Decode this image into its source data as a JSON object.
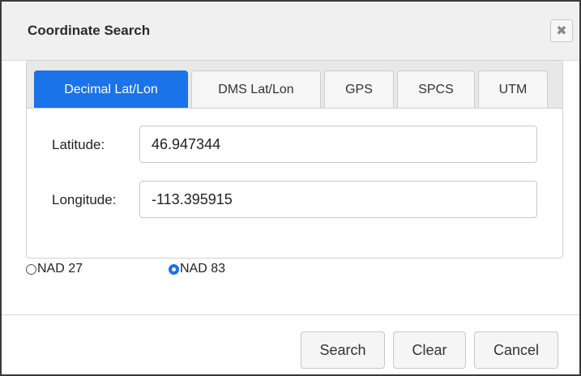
{
  "dialog": {
    "title": "Coordinate Search",
    "close_icon": "close-icon"
  },
  "tabs": [
    {
      "label": "Decimal Lat/Lon",
      "active": true
    },
    {
      "label": "DMS Lat/Lon",
      "active": false
    },
    {
      "label": "GPS",
      "active": false
    },
    {
      "label": "SPCS",
      "active": false
    },
    {
      "label": "UTM",
      "active": false
    }
  ],
  "fields": {
    "latitude": {
      "label": "Latitude:",
      "value": "46.947344"
    },
    "longitude": {
      "label": "Longitude:",
      "value": "-113.395915"
    }
  },
  "datum": {
    "options": [
      {
        "label": "NAD 27",
        "checked": false
      },
      {
        "label": "NAD 83",
        "checked": true
      }
    ]
  },
  "buttons": {
    "search": "Search",
    "clear": "Clear",
    "cancel": "Cancel"
  },
  "colors": {
    "accent": "#1a73e8",
    "titlebar_bg": "#f0f0f0",
    "tabstrip_bg": "#e8e8e8"
  }
}
